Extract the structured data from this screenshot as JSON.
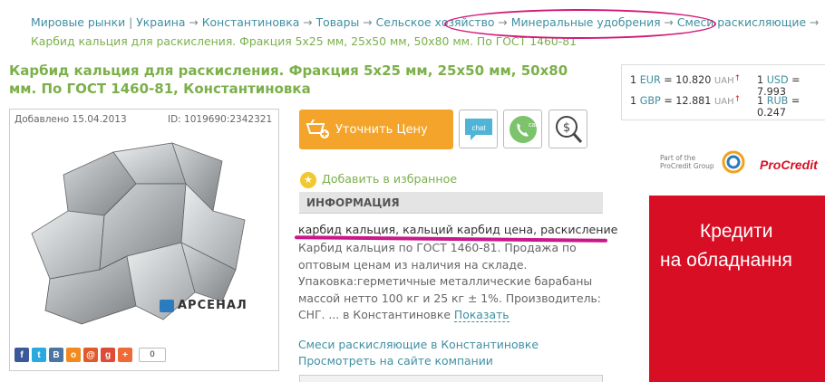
{
  "breadcrumb": {
    "items": [
      "Мировые рынки",
      "Украина",
      "Константиновка",
      "Товары",
      "Сельское хозяйство",
      "Минеральные удобрения",
      "Смеси раскисляющие"
    ],
    "current": "Карбид кальция для раскисления. Фракция 5x25 мм, 25x50 мм, 50x80 мм. По ГОСТ 1460-81",
    "separator": "→",
    "first_separator": "|"
  },
  "product": {
    "title": "Карбид кальция для раскисления. Фракция 5x25 мм, 25x50 мм, 50x80 мм. По ГОСТ 1460-81, Константиновка",
    "added": "Добавлено 15.04.2013",
    "id": "ID: 1019690:2342321",
    "brand": "АРСЕНАЛ",
    "share_count": "0"
  },
  "actions": {
    "price_button": "Уточнить Цену",
    "chat_label": "chat",
    "call_label": "call",
    "favorite": "Добавить в избранное"
  },
  "info": {
    "heading": "ИНФОРМАЦИЯ",
    "tags": "карбид кальция, кальций карбид цена, раскисление",
    "description": "Карбид кальция по ГОСТ 1460-81. Продажа по оптовым ценам из наличия на складе. Упаковка:герметичные металлические барабаны массой нетто 100 кг и 25 кг ± 1%. Производитель: СНГ. ... в Константиновке",
    "more": "Показать",
    "category_link": "Смеси раскисляющие в Константиновке",
    "site_link": "Просмотреть на сайте компании"
  },
  "rates": [
    {
      "amount": "1",
      "currency": "EUR",
      "value": "= 10.820",
      "unit": "UAH"
    },
    {
      "amount": "1",
      "currency": "USD",
      "value": "= 7.993",
      "unit": ""
    },
    {
      "amount": "1",
      "currency": "GBP",
      "value": "= 12.881",
      "unit": "UAH"
    },
    {
      "amount": "1",
      "currency": "RUB",
      "value": "= 0.247",
      "unit": ""
    }
  ],
  "ad": {
    "group_text": "Part of the ProCredit Group",
    "logo": "ProCredit",
    "line1": "Кредити",
    "line2": "на обладнання"
  },
  "colors": {
    "accent_orange": "#f4a42a",
    "title_green": "#7bb04a",
    "link_teal": "#3f8fa0",
    "highlight_magenta": "#d21a7a",
    "ad_red": "#d80f24"
  }
}
